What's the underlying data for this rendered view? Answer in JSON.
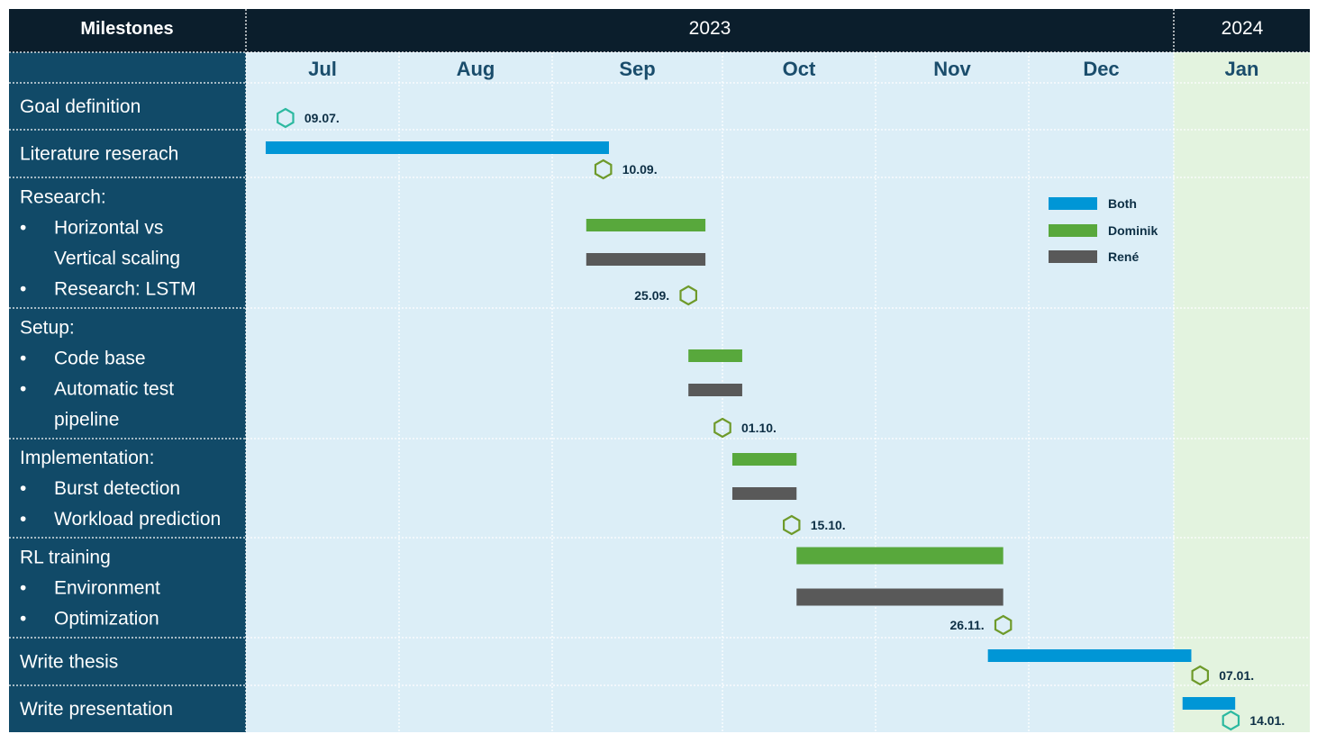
{
  "header": {
    "milestones_label": "Milestones",
    "years": [
      {
        "label": "2023"
      },
      {
        "label": "2024"
      }
    ]
  },
  "colors": {
    "header_bg": "#0B1E2C",
    "sidebar_bg": "#114A68",
    "area_2023": "#DCEEF7",
    "area_2024": "#E3F3DF",
    "both": "#0096D6",
    "dominik": "#58A83C",
    "rene": "#595959",
    "milestone_teal": "#2CB9A0",
    "milestone_green": "#6E9A2A",
    "month_text": "#1A4D6C",
    "label_text": "#0D2F45"
  },
  "chart_data": {
    "type": "gantt",
    "months": [
      "Jul",
      "Aug",
      "Sep",
      "Oct",
      "Nov",
      "Dec",
      "Jan"
    ],
    "legend": [
      {
        "name": "Both",
        "color_key": "both"
      },
      {
        "name": "Dominik",
        "color_key": "dominik"
      },
      {
        "name": "René",
        "color_key": "rene"
      }
    ],
    "rows": [
      {
        "title": "Goal definition",
        "items": []
      },
      {
        "title": "Literature reserach",
        "items": []
      },
      {
        "title": "Research:",
        "items": [
          "Horizontal vs",
          "Vertical scaling",
          "Research: LSTM"
        ],
        "bullets": [
          true,
          false,
          true
        ]
      },
      {
        "title": "Setup:",
        "items": [
          "Code base",
          "Automatic test",
          "pipeline"
        ],
        "bullets": [
          true,
          true,
          false
        ]
      },
      {
        "title": "Implementation:",
        "items": [
          "Burst detection",
          "Workload prediction"
        ],
        "bullets": [
          true,
          true
        ]
      },
      {
        "title": "RL training",
        "items": [
          "Environment",
          "Optimization"
        ],
        "bullets": [
          true,
          true
        ]
      },
      {
        "title": "Write thesis",
        "items": []
      },
      {
        "title": "Write presentation",
        "items": []
      }
    ],
    "tasks": [
      {
        "row": 1,
        "who": "both",
        "start": "2023-07-05",
        "end": "2023-09-11"
      },
      {
        "row": 2,
        "who": "dominik",
        "start": "2023-09-07",
        "end": "2023-09-28"
      },
      {
        "row": 2,
        "who": "rene",
        "start": "2023-09-07",
        "end": "2023-09-28"
      },
      {
        "row": 3,
        "who": "dominik",
        "start": "2023-09-25",
        "end": "2023-10-05"
      },
      {
        "row": 3,
        "who": "rene",
        "start": "2023-09-25",
        "end": "2023-10-05"
      },
      {
        "row": 4,
        "who": "dominik",
        "start": "2023-10-03",
        "end": "2023-10-16"
      },
      {
        "row": 4,
        "who": "rene",
        "start": "2023-10-03",
        "end": "2023-10-16"
      },
      {
        "row": 5,
        "who": "dominik",
        "start": "2023-10-16",
        "end": "2023-11-26"
      },
      {
        "row": 5,
        "who": "rene",
        "start": "2023-10-16",
        "end": "2023-11-26"
      },
      {
        "row": 6,
        "who": "both",
        "start": "2023-11-23",
        "end": "2024-01-05"
      },
      {
        "row": 7,
        "who": "both",
        "start": "2024-01-03",
        "end": "2024-01-15"
      }
    ],
    "milestones": [
      {
        "row": 0,
        "date": "2023-07-09",
        "label": "09.07.",
        "style": "teal",
        "label_side": "right"
      },
      {
        "row": 1,
        "date": "2023-09-10",
        "label": "10.09.",
        "style": "green",
        "label_side": "right"
      },
      {
        "row": 2,
        "date": "2023-09-25",
        "label": "25.09.",
        "style": "green",
        "label_side": "left"
      },
      {
        "row": 3,
        "date": "2023-10-01",
        "label": "01.10.",
        "style": "green",
        "label_side": "right"
      },
      {
        "row": 4,
        "date": "2023-10-15",
        "label": "15.10.",
        "style": "green",
        "label_side": "right"
      },
      {
        "row": 5,
        "date": "2023-11-26",
        "label": "26.11.",
        "style": "green",
        "label_side": "left"
      },
      {
        "row": 6,
        "date": "2024-01-07",
        "label": "07.01.",
        "style": "green",
        "label_side": "right"
      },
      {
        "row": 7,
        "date": "2024-01-14",
        "label": "14.01.",
        "style": "teal",
        "label_side": "right"
      }
    ]
  }
}
